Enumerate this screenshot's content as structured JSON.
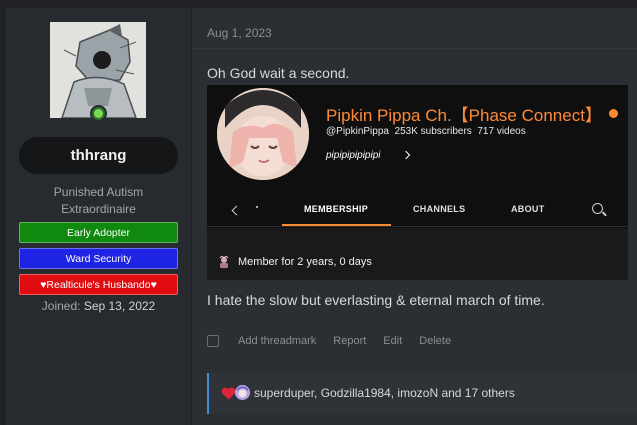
{
  "user": {
    "username": "thhrang",
    "title_line1": "Punished Autism",
    "title_line2": "Extraordinaire",
    "banners": [
      "Early Adopter",
      "Ward Security",
      "♥Realticule's Husbando♥"
    ],
    "joined_label": "Joined:",
    "joined_date": "Sep 13, 2022",
    "avatar_icon": "illustrated-character-avatar",
    "online_icon": "online-indicator-icon"
  },
  "post": {
    "date": "Aug 1, 2023",
    "text1": "Oh God wait a second.",
    "text2": "I hate the slow but everlasting & eternal march of time."
  },
  "embed": {
    "channel_name": "Pipkin Pippa Ch.【Phase Connect】",
    "handle": "@PipkinPippa",
    "subscribers": "253K subscribers",
    "videos": "717 videos",
    "tagline": "pipipipipipipi",
    "tabs": [
      "MEMBERSHIP",
      "CHANNELS",
      "ABOUT"
    ],
    "member_status": "Member for 2 years, 0 days",
    "accent_color": "#ff8a36"
  },
  "actions": {
    "threadmark": "Add threadmark",
    "report": "Report",
    "edit": "Edit",
    "delete": "Delete"
  },
  "reactions": {
    "text": "superduper, Godzilla1984, imozoN and 17 others",
    "icons": [
      "heart-icon",
      "anime-girl-reaction-icon"
    ]
  }
}
